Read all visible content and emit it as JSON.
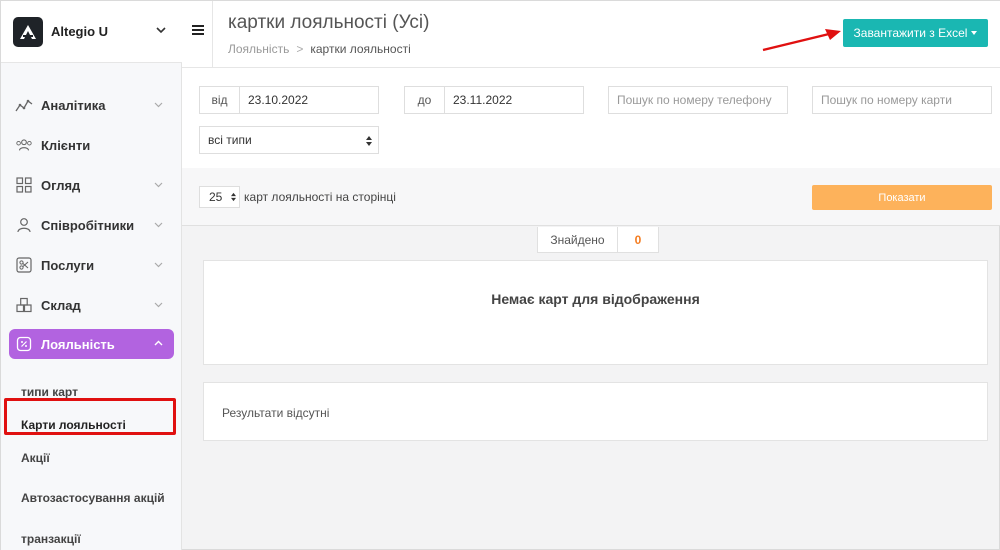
{
  "brand": {
    "name": "Altegio U"
  },
  "sidebar": {
    "items": [
      {
        "label": "Аналітика",
        "icon": "analytics-icon",
        "has_chevron": true
      },
      {
        "label": "Клієнти",
        "icon": "clients-icon",
        "has_chevron": false
      },
      {
        "label": "Огляд",
        "icon": "overview-icon",
        "has_chevron": true
      },
      {
        "label": "Співробітники",
        "icon": "staff-icon",
        "has_chevron": true
      },
      {
        "label": "Послуги",
        "icon": "services-icon",
        "has_chevron": true
      },
      {
        "label": "Склад",
        "icon": "warehouse-icon",
        "has_chevron": true
      },
      {
        "label": "Лояльність",
        "icon": "loyalty-icon",
        "has_chevron": true,
        "active": true
      }
    ],
    "subitems": [
      {
        "label": "типи карт"
      },
      {
        "label": "Карти лояльності",
        "selected": true
      },
      {
        "label": "Акції"
      },
      {
        "label": "Автозастосування акцій"
      },
      {
        "label": "транзакції"
      }
    ],
    "active_color": "#b263e0"
  },
  "header": {
    "title": "картки лояльності (Усі)",
    "breadcrumb": {
      "parent": "Лояльність",
      "separator": ">",
      "current": "картки лояльності"
    },
    "excel_button": {
      "label": "Завантажити з Excel",
      "color": "#1ab7b2"
    }
  },
  "filters": {
    "from": {
      "label": "від",
      "value": "23.10.2022"
    },
    "to": {
      "label": "до",
      "value": "23.11.2022"
    },
    "phone_search": {
      "placeholder": "Пошук по номеру телефону"
    },
    "card_search": {
      "placeholder": "Пошук по номеру карти"
    },
    "type_select": {
      "value": "всі типи"
    }
  },
  "controls": {
    "per_page_value": "25",
    "per_page_label": "карт лояльності на сторінці",
    "show_button": {
      "label": "Показати",
      "color": "#fdb25b"
    }
  },
  "found": {
    "label": "Знайдено",
    "count": "0"
  },
  "empty_message": "Немає карт для відображення",
  "results_message": "Результати відсутні",
  "annotation": {
    "highlight_color": "#e01010"
  }
}
